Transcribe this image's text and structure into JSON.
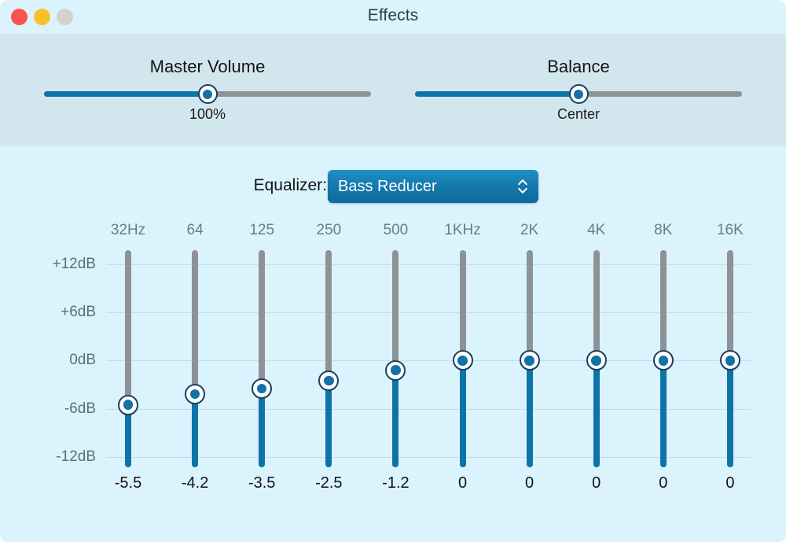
{
  "window": {
    "title": "Effects",
    "traffic_lights": [
      {
        "name": "close",
        "color": "#F9534E"
      },
      {
        "name": "minimize",
        "color": "#F8C02C"
      },
      {
        "name": "zoom",
        "color": "#D4D1CE"
      }
    ],
    "background": "#DBF3FD",
    "top_panel_background": "#D2E6EE"
  },
  "sliders": {
    "master_volume": {
      "label": "Master Volume",
      "value_text": "100%",
      "fill_percent": 50
    },
    "balance": {
      "label": "Balance",
      "value_text": "Center",
      "fill_percent": 50
    }
  },
  "equalizer": {
    "label": "Equalizer:",
    "preset": "Bass Reducer",
    "stepper_icon": "chevron-up-down-icon",
    "accent_color": "#1478AC",
    "track_color": "#8C9296",
    "fill_color": "#0D74A8"
  },
  "chart_data": {
    "type": "bar",
    "title": "Bass Reducer",
    "xlabel": "",
    "ylabel": "dB",
    "ylim": [
      -12,
      12
    ],
    "grid": true,
    "db_ticks": [
      "+12dB",
      "+6dB",
      "0dB",
      "-6dB",
      "-12dB"
    ],
    "db_tick_values": [
      12,
      6,
      0,
      -6,
      -12
    ],
    "categories": [
      "32Hz",
      "64",
      "125",
      "250",
      "500",
      "1KHz",
      "2K",
      "4K",
      "8K",
      "16K"
    ],
    "values": [
      -5.5,
      -4.2,
      -3.5,
      -2.5,
      -1.2,
      0,
      0,
      0,
      0,
      0
    ],
    "value_labels": [
      "-5.5",
      "-4.2",
      "-3.5",
      "-2.5",
      "-1.2",
      "0",
      "0",
      "0",
      "0",
      "0"
    ]
  }
}
